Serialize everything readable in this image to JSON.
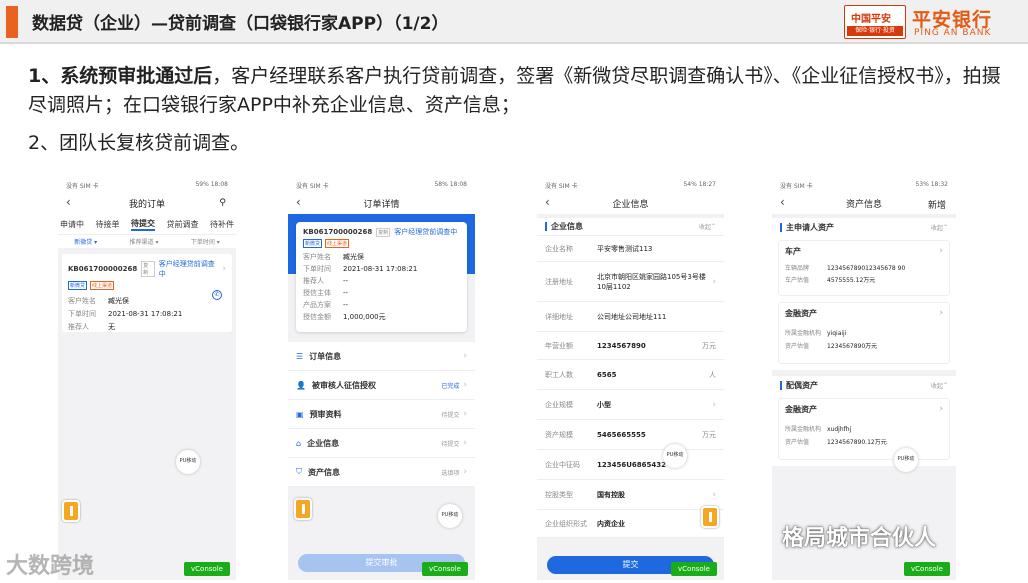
{
  "header": {
    "title": "数据贷（企业）—贷前调查（口袋银行家APP）（1/2）"
  },
  "logo": {
    "cn_small": "中国平安",
    "tag": "保险·银行·投资",
    "cn": "平安银行",
    "en": "PING AN BANK"
  },
  "body": {
    "p1_bold": "1、系统预审批通过后",
    "p1_rest": "，客户经理联系客户执行贷前调查，签署《新微贷尽职调查确认书》、《企业征信授权书》，拍摄尽调照片；在口袋银行家APP中补充企业信息、资产信息；",
    "p2": "2、团队长复核贷前调查。"
  },
  "common": {
    "vconsole": "vConsole",
    "pu": "PU移动"
  },
  "phone1": {
    "status_left": "没有 SIM 卡",
    "status_right": "59% 18:08",
    "title": "我的订单",
    "tabs": [
      "申请中",
      "待接单",
      "待提交",
      "贷前调查",
      "待补件"
    ],
    "filters": [
      "新微贷 ▾",
      "推荐渠道 ▾",
      "下单时间 ▾"
    ],
    "card": {
      "id": "KB061700000268",
      "tag": "复制",
      "status": "客户经理贷前调查中",
      "badges": [
        "新微贷",
        "线上渠道"
      ],
      "fields": [
        {
          "label": "客户姓名",
          "value": "臧光俣"
        },
        {
          "label": "下单时间",
          "value": "2021-08-31 17:08:21"
        },
        {
          "label": "推荐人",
          "value": "无"
        }
      ]
    }
  },
  "phone2": {
    "status_left": "没有 SIM 卡",
    "status_right": "58% 18:08",
    "title": "订单详情",
    "card": {
      "id": "KB061700000268",
      "tag": "复制",
      "status": "客户经理贷前调查中",
      "badges": [
        "新微贷",
        "线上渠道"
      ],
      "fields": [
        {
          "label": "客户姓名",
          "value": "臧光俣"
        },
        {
          "label": "下单时间",
          "value": "2021-08-31 17:08:21"
        },
        {
          "label": "推荐人",
          "value": "--"
        },
        {
          "label": "授信主体",
          "value": "--"
        },
        {
          "label": "产品方案",
          "value": "--"
        },
        {
          "label": "授信金额",
          "value": "1,000,000元"
        }
      ]
    },
    "menu": [
      {
        "label": "订单信息",
        "status": ""
      },
      {
        "label": "被审核人征信授权",
        "status": "已完成"
      },
      {
        "label": "预审资料",
        "status": "待提交"
      },
      {
        "label": "企业信息",
        "status": "待提交"
      },
      {
        "label": "资产信息",
        "status": "选填项"
      }
    ],
    "submit": "提交审批"
  },
  "phone3": {
    "status_left": "没有 SIM 卡",
    "status_right": "54% 18:27",
    "title": "企业信息",
    "section": "企业信息",
    "collapse": "收起",
    "rows": [
      {
        "label": "企业名称",
        "value": "平安零售测试113",
        "unit": ""
      },
      {
        "label": "注册地址",
        "value": "北京市朝阳区姚家园路105号3号楼10层1102",
        "unit": ""
      },
      {
        "label": "详细地址",
        "value": "公司地址公司地址111",
        "unit": ""
      },
      {
        "label": "年营业额",
        "value": "1234567890",
        "unit": "万元"
      },
      {
        "label": "职工人数",
        "value": "6565",
        "unit": "人"
      },
      {
        "label": "企业规模",
        "value": "小型",
        "unit": ""
      },
      {
        "label": "资产规模",
        "value": "5465665555",
        "unit": "万元"
      },
      {
        "label": "企业中征码",
        "value": "123456U6865432",
        "unit": ""
      },
      {
        "label": "控股类型",
        "value": "国有控股",
        "unit": ""
      },
      {
        "label": "企业组织形式",
        "value": "内资企业",
        "unit": ""
      }
    ],
    "submit": "提交"
  },
  "phone4": {
    "status_left": "没有 SIM 卡",
    "status_right": "53% 18:32",
    "title": "资产信息",
    "right": "新增",
    "sec1": "主申请人资产",
    "sec2": "配偶资产",
    "collapse": "收起",
    "car": {
      "title": "车产",
      "rows": [
        {
          "label": "车辆品牌",
          "value": "123456789012345678 90"
        },
        {
          "label": "车产估值",
          "value": "4575555.12万元"
        }
      ]
    },
    "fin1": {
      "title": "金融资产",
      "rows": [
        {
          "label": "所属金融机构",
          "value": "yiqiaiji"
        },
        {
          "label": "资产估值",
          "value": "1234567890万元"
        }
      ]
    },
    "fin2": {
      "title": "金融资产",
      "rows": [
        {
          "label": "所属金融机构",
          "value": "xudjhfhj"
        },
        {
          "label": "资产估值",
          "value": "1234567890.12万元"
        }
      ]
    }
  },
  "watermarks": {
    "left": "大数跨境",
    "right": "格局城市合伙人"
  }
}
